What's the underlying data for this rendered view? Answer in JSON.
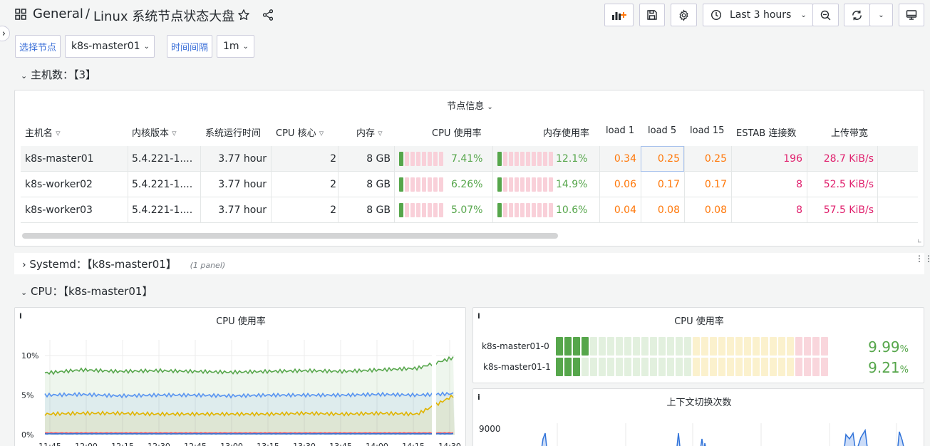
{
  "header": {
    "folder": "General",
    "separator": "/",
    "title": "Linux 系统节点状态大盘",
    "time_range": "Last 3 hours"
  },
  "variables": [
    {
      "label": "选择节点",
      "value": "k8s-master01"
    },
    {
      "label": "时间间隔",
      "value": "1m"
    }
  ],
  "rows": {
    "hosts": "主机数：【3】",
    "systemd": "Systemd：【k8s-master01】",
    "systemd_note": "(1 panel)",
    "cpu": "CPU：【k8s-master01】"
  },
  "node_table": {
    "title": "节点信息",
    "columns": [
      "主机名",
      "内核版本",
      "系统运行时间",
      "CPU 核心",
      "内存",
      "CPU 使用率",
      "内存使用率",
      "load 1",
      "load 5",
      "load 15",
      "ESTAB 连接数",
      "上传带宽"
    ],
    "rows": [
      {
        "host": "k8s-master01",
        "kernel": "5.4.221-1....",
        "uptime": "3.77 hour",
        "cores": "2",
        "mem": "8 GB",
        "cpu": "7.41%",
        "cpu_frac": 0.0741,
        "memuse": "12.1%",
        "mem_frac": 0.121,
        "l1": "0.34",
        "l5": "0.25",
        "l15": "0.25",
        "estab": "196",
        "up": "28.7 KiB/s"
      },
      {
        "host": "k8s-worker02",
        "kernel": "5.4.221-1....",
        "uptime": "3.77 hour",
        "cores": "2",
        "mem": "8 GB",
        "cpu": "6.26%",
        "cpu_frac": 0.0626,
        "memuse": "14.9%",
        "mem_frac": 0.149,
        "l1": "0.06",
        "l5": "0.17",
        "l15": "0.17",
        "estab": "8",
        "up": "52.5 KiB/s"
      },
      {
        "host": "k8s-worker03",
        "kernel": "5.4.221-1....",
        "uptime": "3.77 hour",
        "cores": "2",
        "mem": "8 GB",
        "cpu": "5.07%",
        "cpu_frac": 0.0507,
        "memuse": "10.6%",
        "mem_frac": 0.106,
        "l1": "0.04",
        "l5": "0.08",
        "l15": "0.08",
        "estab": "8",
        "up": "57.5 KiB/s"
      }
    ]
  },
  "cpu_gauge_panel": {
    "title": "CPU 使用率",
    "items": [
      {
        "name": "k8s-master01-0",
        "value": "9.99",
        "unit": "%",
        "frac": 0.0999
      },
      {
        "name": "k8s-master01-1",
        "value": "9.21",
        "unit": "%",
        "frac": 0.0921
      }
    ]
  },
  "ctx_panel": {
    "title": "上下文切换次数",
    "ytick": "9000"
  },
  "info_icon": "i",
  "chart_data": {
    "type": "line",
    "title": "CPU 使用率",
    "x": [
      "11:45",
      "12:00",
      "12:15",
      "12:30",
      "12:45",
      "13:00",
      "13:15",
      "13:30",
      "13:45",
      "14:00",
      "14:15",
      "14:30"
    ],
    "yticks": [
      "10%",
      "5%",
      "0%"
    ],
    "ylim": [
      0,
      12
    ],
    "series": [
      {
        "color": "#56a64b",
        "values": [
          7.8,
          8.2,
          8.0,
          8.1,
          8.0,
          7.9,
          8.0,
          8.1,
          8.0,
          8.2,
          8.4,
          9.8
        ]
      },
      {
        "color": "#5794f2",
        "values": [
          5.0,
          5.1,
          4.9,
          5.0,
          5.0,
          4.9,
          5.0,
          5.0,
          5.0,
          5.1,
          5.0,
          5.2
        ]
      },
      {
        "color": "#e0b400",
        "values": [
          2.6,
          2.7,
          2.7,
          2.6,
          2.6,
          2.6,
          2.6,
          2.7,
          2.6,
          2.7,
          2.6,
          5.0
        ]
      },
      {
        "color": "#f2495c",
        "values": [
          0.2,
          0.2,
          0.2,
          0.2,
          0.2,
          0.2,
          0.2,
          0.2,
          0.2,
          0.2,
          0.2,
          0.2
        ]
      },
      {
        "color": "#3274d9",
        "values": [
          0.1,
          0.1,
          0.1,
          0.1,
          0.1,
          0.1,
          0.1,
          0.1,
          0.1,
          0.1,
          0.1,
          0.1
        ]
      }
    ],
    "grid": true
  }
}
